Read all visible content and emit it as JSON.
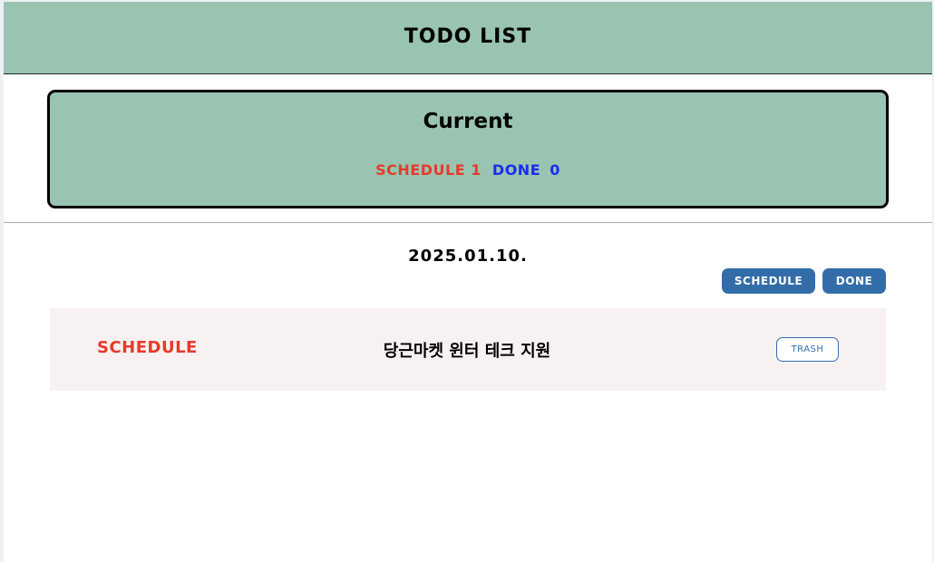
{
  "header": {
    "title": "TODO LIST"
  },
  "summary": {
    "title": "Current",
    "schedule_label": "SCHEDULE",
    "schedule_count": "1",
    "done_label": "DONE",
    "done_count": "0"
  },
  "date": "2025.01.10.",
  "filters": {
    "schedule_label": "SCHEDULE",
    "done_label": "DONE"
  },
  "todos": [
    {
      "status": "SCHEDULE",
      "title": "당근마켓 윈터 테크 지원",
      "trash_label": "TRASH"
    }
  ],
  "colors": {
    "header_bg": "#98c4b1",
    "schedule": "#e8392b",
    "done": "#1a2cf0",
    "button": "#336da9",
    "row_bg": "#f8f1f1"
  }
}
